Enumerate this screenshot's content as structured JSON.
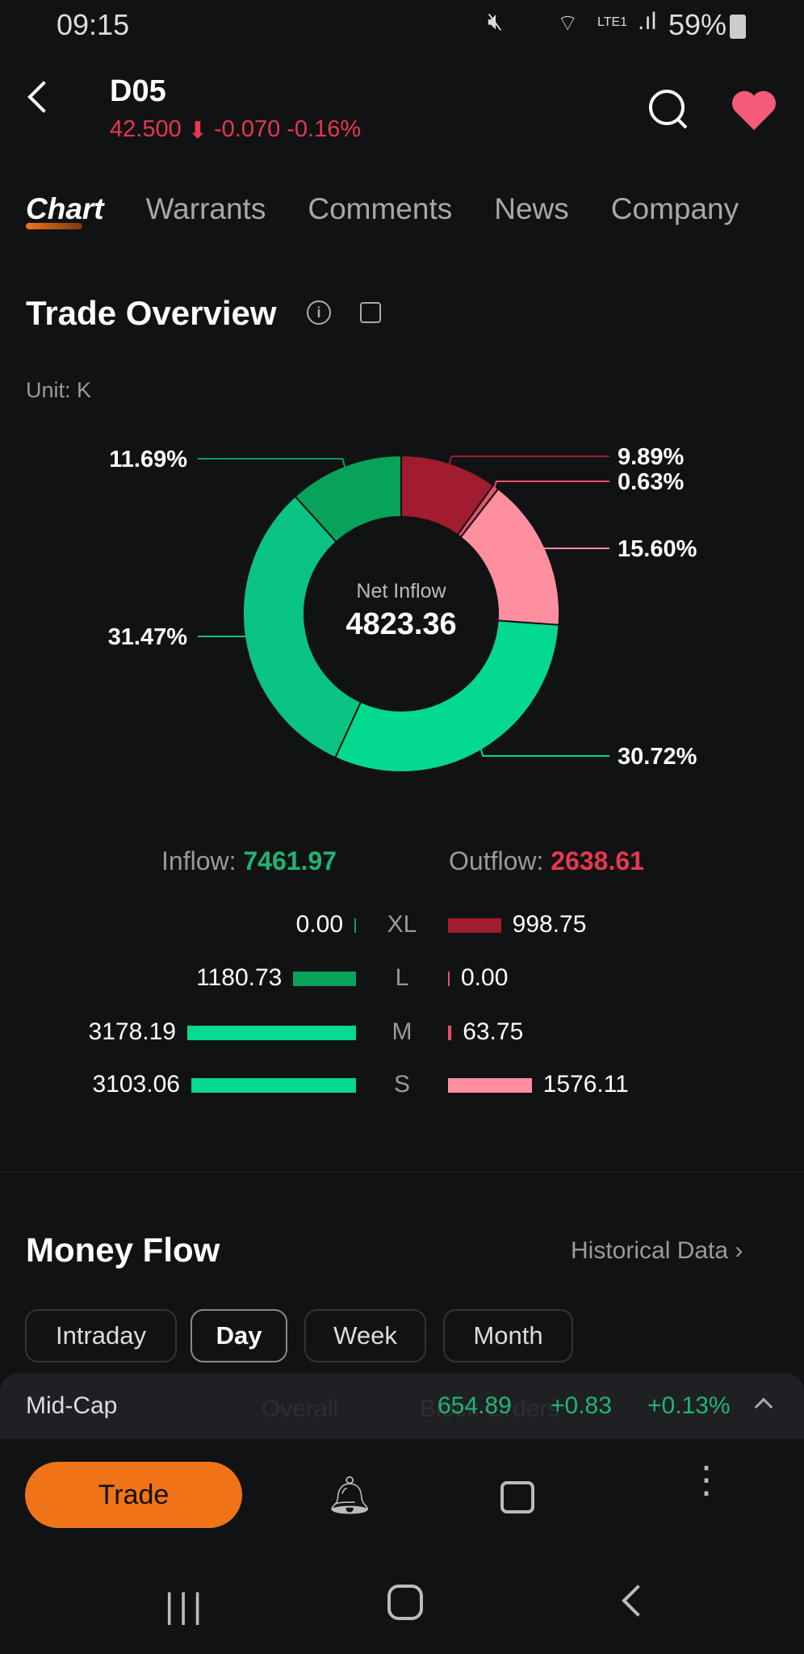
{
  "status_bar": {
    "time": "09:15",
    "battery": "59%",
    "network": "LTE1"
  },
  "header": {
    "symbol": "D05",
    "price": "42.500",
    "change": "-0.070",
    "change_pct": "-0.16%",
    "favorite_color": "#f45b78"
  },
  "tabs": [
    {
      "label": "Chart",
      "active": true
    },
    {
      "label": "Warrants"
    },
    {
      "label": "Comments"
    },
    {
      "label": "News"
    },
    {
      "label": "Company"
    }
  ],
  "trade_overview": {
    "title": "Trade Overview",
    "unit": "Unit: K",
    "center_label": "Net Inflow",
    "center_value": "4823.36",
    "inflow_label": "Inflow:",
    "inflow_value": "7461.97",
    "outflow_label": "Outflow:",
    "outflow_value": "2638.61",
    "rows": [
      {
        "size": "XL",
        "inflow": "0.00",
        "outflow": "998.75"
      },
      {
        "size": "L",
        "inflow": "1180.73",
        "outflow": "0.00"
      },
      {
        "size": "M",
        "inflow": "3178.19",
        "outflow": "63.75"
      },
      {
        "size": "S",
        "inflow": "3103.06",
        "outflow": "1576.11"
      }
    ]
  },
  "chart_data": {
    "type": "pie",
    "slices": [
      {
        "label": "9.89%",
        "value": 9.89,
        "color": "#a01c2e"
      },
      {
        "label": "0.63%",
        "value": 0.63,
        "color": "#e8506a"
      },
      {
        "label": "15.60%",
        "value": 15.6,
        "color": "#ff8f9f"
      },
      {
        "label": "30.72%",
        "value": 30.72,
        "color": "#03d98f"
      },
      {
        "label": "31.47%",
        "value": 31.47,
        "color": "#0bc383"
      },
      {
        "label": "11.69%",
        "value": 11.69,
        "color": "#07a35a"
      }
    ]
  },
  "money_flow": {
    "title": "Money Flow",
    "historical": "Historical Data",
    "periods": [
      "Intraday",
      "Day",
      "Week",
      "Month"
    ],
    "selected": "Day"
  },
  "ticker_bar": {
    "name": "Mid-Cap",
    "value": "654.89",
    "change": "+0.83",
    "change_pct": "+0.13%",
    "behind_1": "Overall",
    "behind_2": "Block Orders"
  },
  "bottom": {
    "trade": "Trade"
  }
}
